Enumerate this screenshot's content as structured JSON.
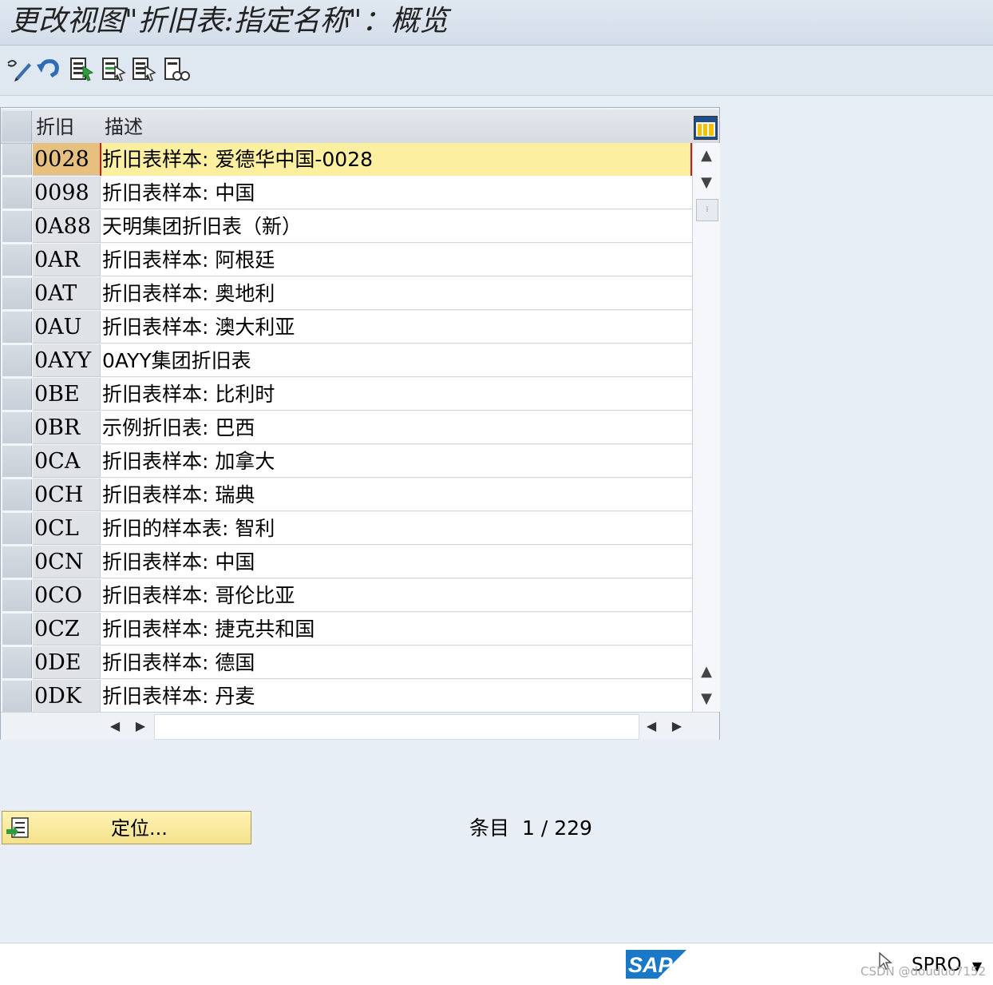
{
  "window": {
    "title": "更改视图\"折旧表:指定名称\"：概览"
  },
  "toolbar": {
    "buttons": [
      {
        "name": "display-change-icon"
      },
      {
        "name": "undo-icon"
      },
      {
        "name": "select-all-icon"
      },
      {
        "name": "select-block-icon"
      },
      {
        "name": "deselect-all-icon"
      },
      {
        "name": "find-icon"
      }
    ]
  },
  "table": {
    "columns": {
      "key": "折旧",
      "desc": "描述"
    },
    "rows": [
      {
        "key": "0028",
        "desc": "折旧表样本: 爱德华中国-0028"
      },
      {
        "key": "0098",
        "desc": "折旧表样本: 中国"
      },
      {
        "key": "0A88",
        "desc": "天明集团折旧表（新）"
      },
      {
        "key": "0AR",
        "desc": "折旧表样本: 阿根廷"
      },
      {
        "key": "0AT",
        "desc": "折旧表样本: 奥地利"
      },
      {
        "key": "0AU",
        "desc": "折旧表样本: 澳大利亚"
      },
      {
        "key": "0AYY",
        "desc": "0AYY集团折旧表"
      },
      {
        "key": "0BE",
        "desc": "折旧表样本: 比利时"
      },
      {
        "key": "0BR",
        "desc": "示例折旧表: 巴西"
      },
      {
        "key": "0CA",
        "desc": "折旧表样本: 加拿大"
      },
      {
        "key": "0CH",
        "desc": "折旧表样本: 瑞典"
      },
      {
        "key": "0CL",
        "desc": "折旧的样本表: 智利"
      },
      {
        "key": "0CN",
        "desc": "折旧表样本: 中国"
      },
      {
        "key": "0CO",
        "desc": "折旧表样本: 哥伦比亚"
      },
      {
        "key": "0CZ",
        "desc": "折旧表样本: 捷克共和国"
      },
      {
        "key": "0DE",
        "desc": "折旧表样本: 德国"
      },
      {
        "key": "0DK",
        "desc": "折旧表样本: 丹麦"
      }
    ]
  },
  "footer": {
    "locate_label": "定位...",
    "entry_label": "条目",
    "entry_value": "1 / 229"
  },
  "statusbar": {
    "logo": "SAP",
    "tcode": "SPRO",
    "watermark": "CSDN @douduo7152"
  },
  "colors": {
    "active_key": "#e6c07e",
    "active_desc": "#fcefa0",
    "button": "#f5e28c"
  }
}
